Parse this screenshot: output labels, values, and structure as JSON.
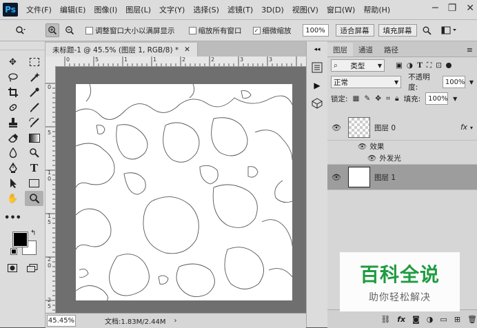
{
  "app": {
    "logo": "Ps"
  },
  "menu": [
    "文件(F)",
    "编辑(E)",
    "图像(I)",
    "图层(L)",
    "文字(Y)",
    "选择(S)",
    "滤镜(T)",
    "3D(D)",
    "视图(V)",
    "窗口(W)",
    "帮助(H)"
  ],
  "options": {
    "resize_windows": "调整窗口大小以满屏显示",
    "zoom_all": "缩放所有窗口",
    "scrubby_zoom": "细微缩放",
    "zoom_value": "100%",
    "fit_screen": "适合屏幕",
    "fill_screen": "填充屏幕",
    "scrubby_checked": true
  },
  "document": {
    "tab_title": "未标题-1 @ 45.5% (图层 1, RGB/8) *",
    "ruler_h": [
      "0",
      "5",
      "1",
      "1",
      "2",
      "2",
      "3",
      "3"
    ],
    "ruler_v": [
      "0",
      "5",
      "1",
      "0",
      "1",
      "5",
      "2",
      "0",
      "2",
      "5"
    ],
    "zoom": "45.45%",
    "doc_info": "文档:1.83M/2.44M"
  },
  "layers_panel": {
    "tabs": [
      "图层",
      "通道",
      "路径"
    ],
    "filter_kind": "类型",
    "blend_mode": "正常",
    "opacity_label": "不透明度:",
    "opacity": "100%",
    "lock_label": "锁定:",
    "fill_label": "填充:",
    "fill": "100%",
    "layers": [
      {
        "name": "图层 0",
        "fx": "fx",
        "effects_label": "效果",
        "effect": "外发光"
      },
      {
        "name": "图层 1"
      }
    ]
  },
  "watermark": {
    "main": "百科全说",
    "sub": "助你轻松解决"
  }
}
